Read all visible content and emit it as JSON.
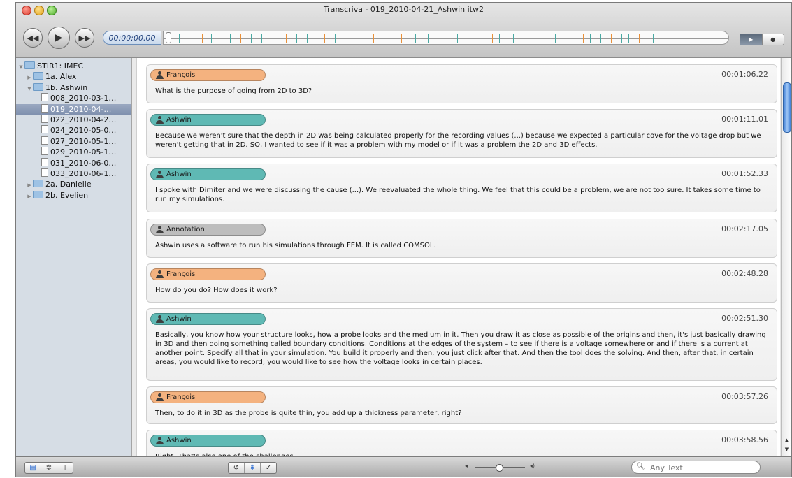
{
  "window": {
    "title": "Transcriva - 019_2010-04-21_Ashwin itw2"
  },
  "toolbar": {
    "rewind_icon": "rewind-icon",
    "play_icon": "play-icon",
    "forward_icon": "fast-forward-icon",
    "timecode": "00:00:00.00",
    "mode_play_label": "▶",
    "mode_record_label": "●"
  },
  "sidebar": {
    "items": [
      {
        "label": "STIR1: IMEC",
        "type": "folder",
        "depth": 0,
        "expanded": true
      },
      {
        "label": "1a. Alex",
        "type": "folder",
        "depth": 1,
        "expanded": false
      },
      {
        "label": "1b. Ashwin",
        "type": "folder",
        "depth": 1,
        "expanded": true
      },
      {
        "label": "008_2010-03-1…",
        "type": "doc",
        "depth": 2
      },
      {
        "label": "019_2010-04-…",
        "type": "doc",
        "depth": 2,
        "selected": true
      },
      {
        "label": "022_2010-04-2…",
        "type": "doc",
        "depth": 2
      },
      {
        "label": "024_2010-05-0…",
        "type": "doc",
        "depth": 2
      },
      {
        "label": "027_2010-05-1…",
        "type": "doc",
        "depth": 2
      },
      {
        "label": "029_2010-05-1…",
        "type": "doc",
        "depth": 2
      },
      {
        "label": "031_2010-06-0…",
        "type": "doc",
        "depth": 2
      },
      {
        "label": "033_2010-06-1…",
        "type": "doc",
        "depth": 2
      },
      {
        "label": "2a. Danielle",
        "type": "folder",
        "depth": 1,
        "expanded": false
      },
      {
        "label": "2b. Evelien",
        "type": "folder",
        "depth": 1,
        "expanded": false
      }
    ]
  },
  "colors": {
    "francois": "#f4b27f",
    "ashwin": "#5fb9b4",
    "annotation": "#bdbdbd",
    "timeline_orange": "#e8903a",
    "timeline_teal": "#4aa8a2"
  },
  "entries": [
    {
      "speaker": "François",
      "role": "francois",
      "time": "00:01:06.22",
      "text": "What is the purpose of going from 2D to 3D?"
    },
    {
      "speaker": "Ashwin",
      "role": "ashwin",
      "time": "00:01:11.01",
      "text": "Because we weren't sure that the depth in 2D was being calculated properly for the recording values (...) because we expected a particular cove for the voltage drop but we weren't getting that in 2D. SO, I wanted to see if it was a problem with my model or if it was a problem the 2D and 3D effects."
    },
    {
      "speaker": "Ashwin",
      "role": "ashwin",
      "time": "00:01:52.33",
      "text": "I spoke with Dimiter and we were discussing the cause (...). We reevaluated the whole thing. We feel that this could be a problem, we are not too sure. It takes some time to run my simulations."
    },
    {
      "speaker": "Annotation",
      "role": "annotation",
      "time": "00:02:17.05",
      "text": "Ashwin uses a software to run his simulations through FEM. It is called COMSOL."
    },
    {
      "speaker": "François",
      "role": "francois",
      "time": "00:02:48.28",
      "text": "How do you do? How does it work?"
    },
    {
      "speaker": "Ashwin",
      "role": "ashwin",
      "time": "00:02:51.30",
      "text": "Basically, you know how your structure looks, how a probe looks and the medium in it. Then you draw it as close as possible of the origins and then, it's just basically drawing in 3D and then doing something called boundary conditions. Conditions at the edges of the system – to see if there is a voltage somewhere or and if there is a current at another point. Specify all that in your simulation. You build it properly and then, you just click after that. And then the tool does the solving. And then, after that, in certain areas, you would like to record, you would like to see how the voltage looks in certain places."
    },
    {
      "speaker": "François",
      "role": "francois",
      "time": "00:03:57.26",
      "text": "Then, to do it in 3D as the probe is quite thin, you add up a thickness parameter, right?"
    },
    {
      "speaker": "Ashwin",
      "role": "ashwin",
      "time": "00:03:58.56",
      "text": "Right. That's also one of the challenges."
    }
  ],
  "bottombar": {
    "left_icons": [
      "document-icon",
      "gear-icon",
      "presentation-icon"
    ],
    "center_icons": [
      "loop-icon",
      "align-icon",
      "checkmark-icon"
    ],
    "search_placeholder": "Any Text"
  }
}
